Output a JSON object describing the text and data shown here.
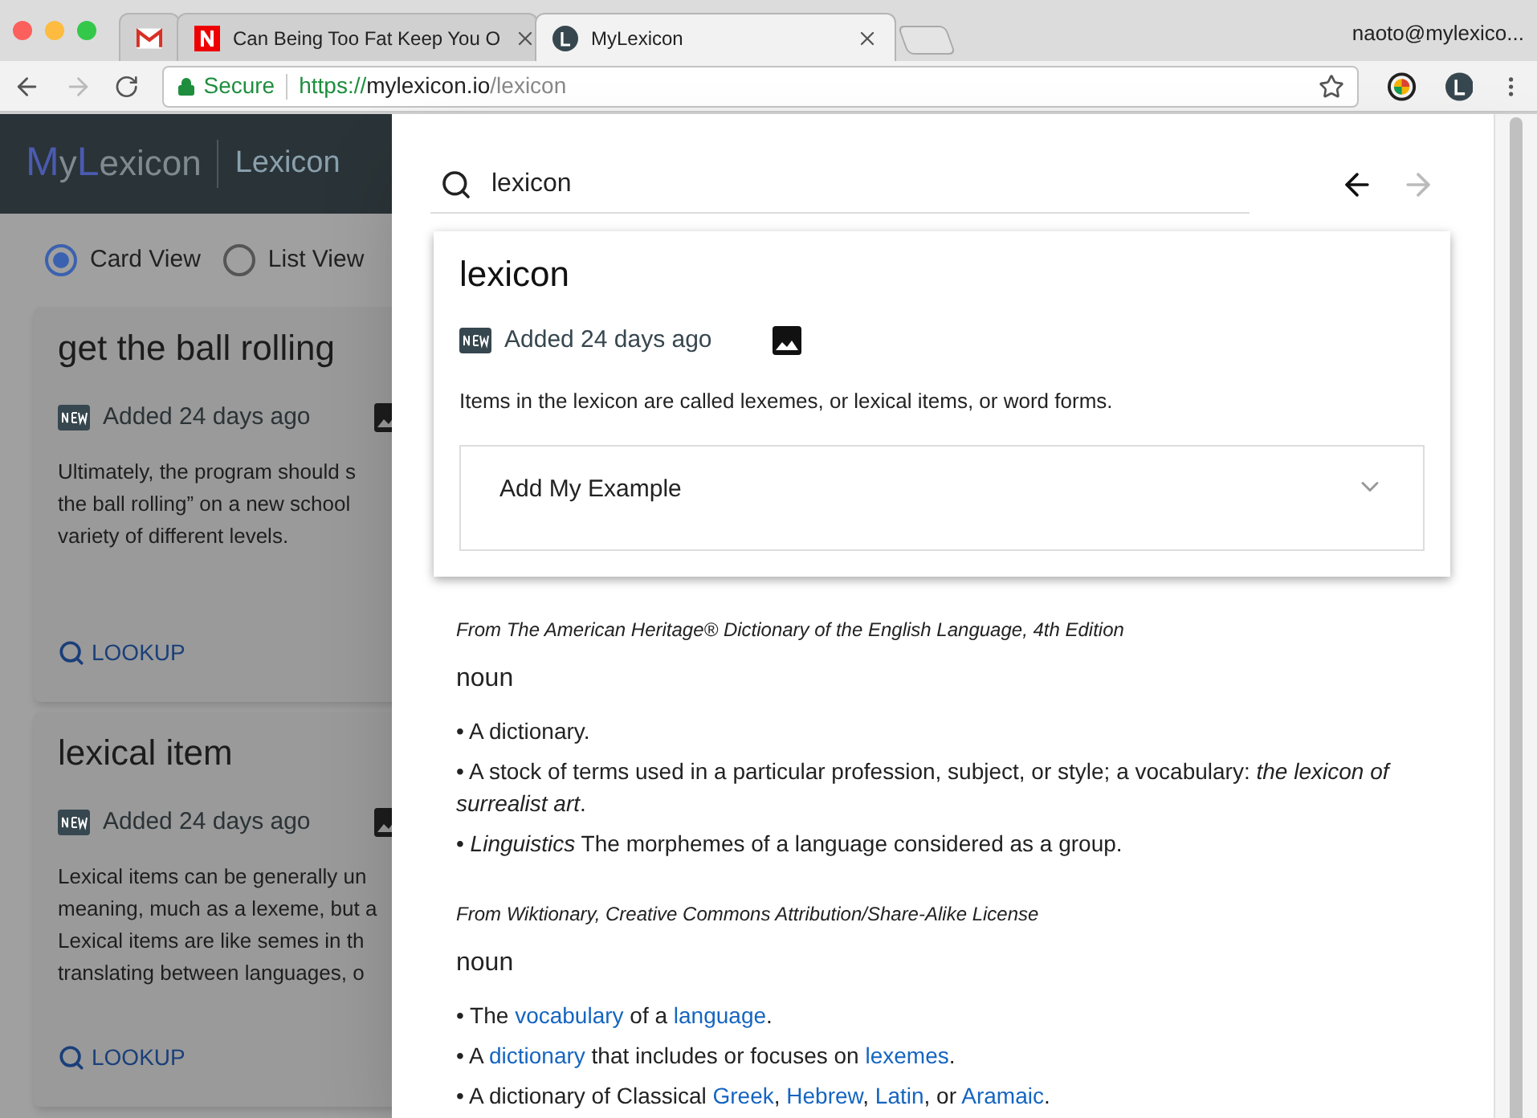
{
  "browser": {
    "tabs": [
      {
        "kind": "mail",
        "selected": false
      },
      {
        "kind": "news",
        "title": "Can Being Too Fat Keep You O",
        "selected": false
      },
      {
        "kind": "app",
        "title": "MyLexicon",
        "selected": true
      }
    ],
    "profile": "naoto@mylexico...",
    "address": {
      "secure_label": "Secure",
      "scheme": "https://",
      "host": "mylexicon.io",
      "path": "/lexicon"
    }
  },
  "app_bar": {
    "logo": [
      {
        "text": "M",
        "accent": true
      },
      {
        "text": "y",
        "accent": false
      },
      {
        "text": "L",
        "accent": true
      },
      {
        "text": "exicon",
        "accent": false
      }
    ],
    "section": "Lexicon"
  },
  "view_options": [
    {
      "label": "Card View",
      "selected": true
    },
    {
      "label": "List View",
      "selected": false
    }
  ],
  "cards": [
    {
      "title": "get the ball rolling",
      "added": "Added 24 days ago",
      "lines": [
        "Ultimately, the program should s",
        "the ball rolling” on a new school",
        "variety of different levels."
      ],
      "action": "LOOKUP"
    },
    {
      "title": "lexical item",
      "added": "Added 24 days ago",
      "lines": [
        "Lexical items can be generally un",
        "meaning, much as a lexeme, but a",
        "Lexical items are like semes in th",
        "translating between languages, o"
      ],
      "action": "LOOKUP"
    }
  ],
  "drawer": {
    "search": {
      "value": "lexicon"
    },
    "back_enabled": true,
    "forward_enabled": false,
    "entry": {
      "word": "lexicon",
      "added": "Added 24 days ago",
      "example": "Items in the lexicon are called lexemes, or lexical items, or word forms.",
      "add_example": {
        "label": "Add My Example",
        "expanded": false
      }
    },
    "sources": [
      {
        "source": "From The American Heritage® Dictionary of the English Language, 4th Edition",
        "part_of_speech": "noun",
        "definitions": [
          [
            {
              "kind": "text",
              "text": "• A dictionary."
            }
          ],
          [
            {
              "kind": "text",
              "text": "• A stock of terms used in a particular profession, subject, or style; a vocabulary: *the lexicon of surrealist art*."
            }
          ],
          [
            {
              "kind": "text",
              "text": "• *Linguistics* The morphemes of a language considered as a group."
            }
          ]
        ]
      },
      {
        "source": "From Wiktionary, Creative Commons Attribution/Share-Alike License",
        "part_of_speech": "noun",
        "definitions": [
          [
            {
              "kind": "text",
              "text": "• The "
            },
            {
              "kind": "link",
              "text": "vocabulary"
            },
            {
              "kind": "text",
              "text": " of a "
            },
            {
              "kind": "link",
              "text": "language"
            },
            {
              "kind": "text",
              "text": "."
            }
          ],
          [
            {
              "kind": "text",
              "text": "• A "
            },
            {
              "kind": "link",
              "text": "dictionary"
            },
            {
              "kind": "text",
              "text": " that includes or focuses on "
            },
            {
              "kind": "link",
              "text": "lexemes"
            },
            {
              "kind": "text",
              "text": "."
            }
          ],
          [
            {
              "kind": "text",
              "text": "• A dictionary of Classical "
            },
            {
              "kind": "link",
              "text": "Greek"
            },
            {
              "kind": "text",
              "text": ", "
            },
            {
              "kind": "link",
              "text": "Hebrew"
            },
            {
              "kind": "text",
              "text": ", "
            },
            {
              "kind": "link",
              "text": "Latin"
            },
            {
              "kind": "text",
              "text": ", or "
            },
            {
              "kind": "link",
              "text": "Aramaic"
            },
            {
              "kind": "text",
              "text": "."
            }
          ]
        ]
      }
    ]
  }
}
